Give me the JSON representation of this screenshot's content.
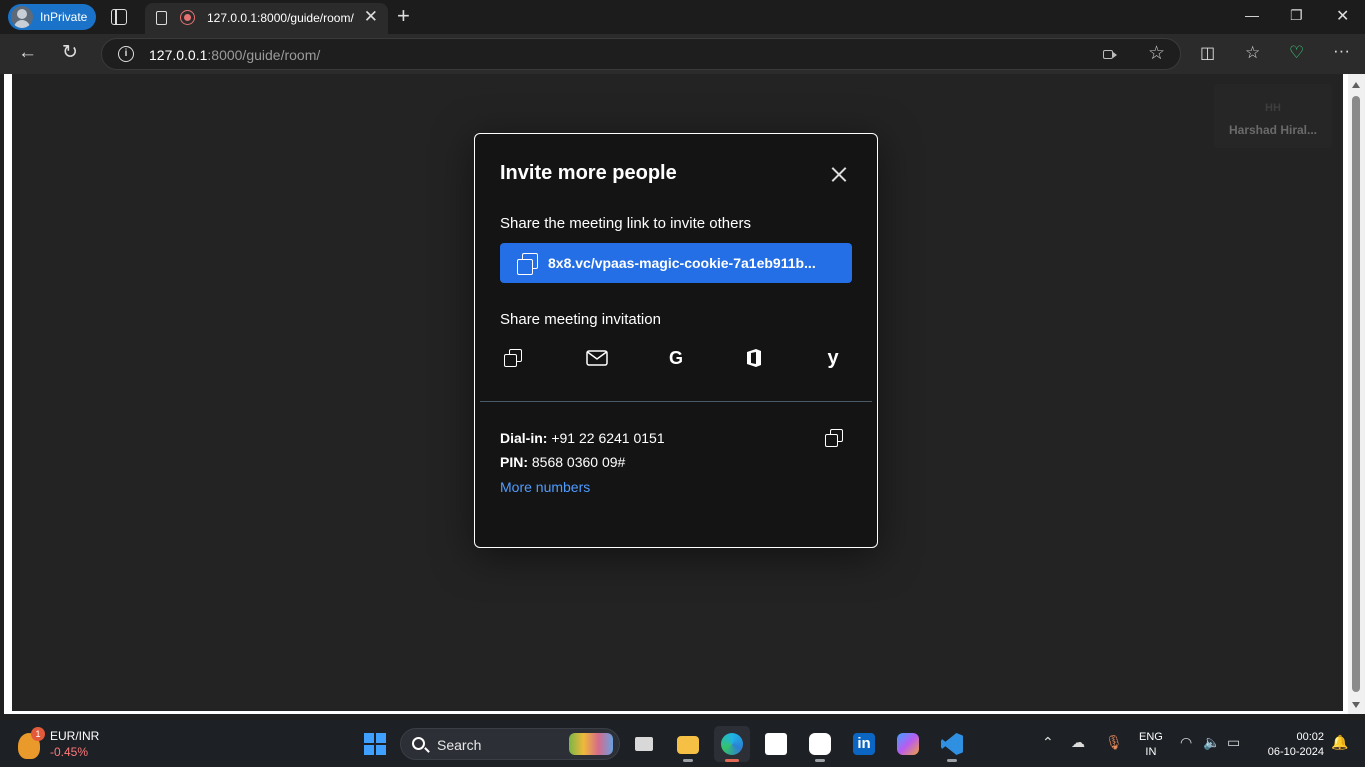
{
  "browser": {
    "profile_label": "InPrivate",
    "tab_title": "127.0.0.1:8000/guide/room/",
    "address": {
      "host": "127.0.0.1",
      "path": ":8000/guide/room/"
    }
  },
  "participant_tile": {
    "initials": "HH",
    "name": "Harshad Hiral..."
  },
  "dialog": {
    "title": "Invite more people",
    "link_section_label": "Share the meeting link to invite others",
    "meeting_link": "8x8.vc/vpaas-magic-cookie-7a1eb911b...",
    "invitation_section_label": "Share meeting invitation",
    "share_icons": [
      "copy-icon",
      "email-icon",
      "google-icon",
      "office-icon",
      "yahoo-icon"
    ],
    "dialin_label": "Dial-in:",
    "dialin_number": "+91 22 6241 0151",
    "pin_label": "PIN:",
    "pin_value": "8568 0360 09#",
    "more_numbers": "More numbers"
  },
  "taskbar": {
    "widget_badge": "1",
    "widget_pair": "EUR/INR",
    "widget_change": "-0.45%",
    "search_label": "Search",
    "lang_top": "ENG",
    "lang_bottom": "IN",
    "time": "00:02",
    "date": "06-10-2024"
  },
  "colors": {
    "accent": "#246fe5",
    "link": "#4f9cff",
    "stage": "#232323",
    "dialog_bg": "#141414"
  }
}
